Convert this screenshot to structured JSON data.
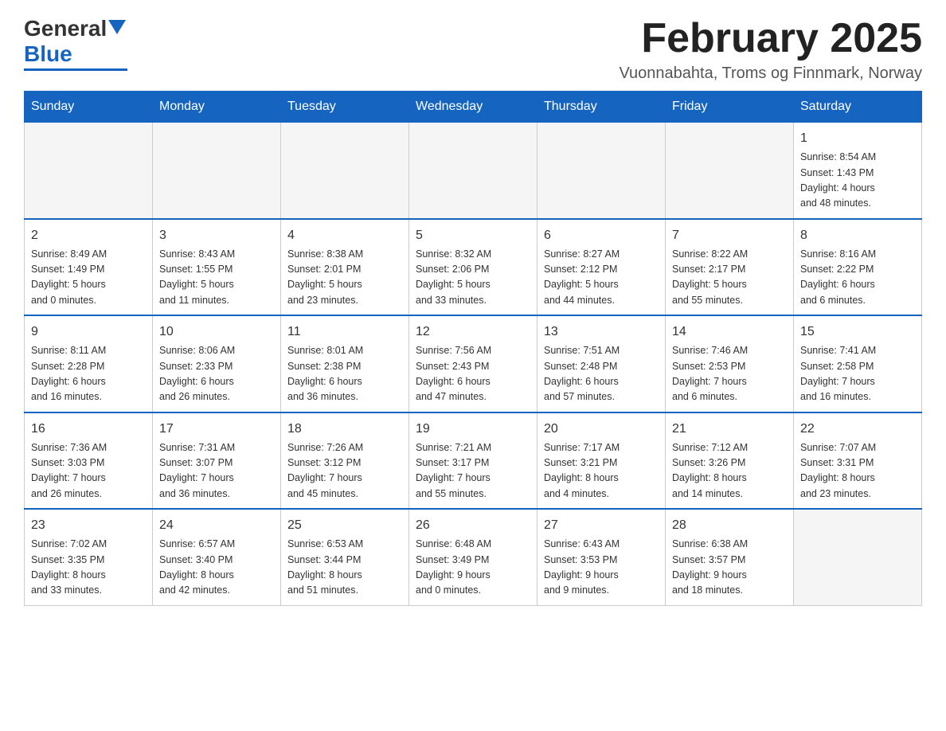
{
  "header": {
    "logo_text_general": "General",
    "logo_text_blue": "Blue",
    "month_title": "February 2025",
    "location": "Vuonnabahta, Troms og Finnmark, Norway"
  },
  "days_of_week": [
    "Sunday",
    "Monday",
    "Tuesday",
    "Wednesday",
    "Thursday",
    "Friday",
    "Saturday"
  ],
  "weeks": [
    {
      "days": [
        {
          "num": "",
          "info": ""
        },
        {
          "num": "",
          "info": ""
        },
        {
          "num": "",
          "info": ""
        },
        {
          "num": "",
          "info": ""
        },
        {
          "num": "",
          "info": ""
        },
        {
          "num": "",
          "info": ""
        },
        {
          "num": "1",
          "info": "Sunrise: 8:54 AM\nSunset: 1:43 PM\nDaylight: 4 hours\nand 48 minutes."
        }
      ]
    },
    {
      "days": [
        {
          "num": "2",
          "info": "Sunrise: 8:49 AM\nSunset: 1:49 PM\nDaylight: 5 hours\nand 0 minutes."
        },
        {
          "num": "3",
          "info": "Sunrise: 8:43 AM\nSunset: 1:55 PM\nDaylight: 5 hours\nand 11 minutes."
        },
        {
          "num": "4",
          "info": "Sunrise: 8:38 AM\nSunset: 2:01 PM\nDaylight: 5 hours\nand 23 minutes."
        },
        {
          "num": "5",
          "info": "Sunrise: 8:32 AM\nSunset: 2:06 PM\nDaylight: 5 hours\nand 33 minutes."
        },
        {
          "num": "6",
          "info": "Sunrise: 8:27 AM\nSunset: 2:12 PM\nDaylight: 5 hours\nand 44 minutes."
        },
        {
          "num": "7",
          "info": "Sunrise: 8:22 AM\nSunset: 2:17 PM\nDaylight: 5 hours\nand 55 minutes."
        },
        {
          "num": "8",
          "info": "Sunrise: 8:16 AM\nSunset: 2:22 PM\nDaylight: 6 hours\nand 6 minutes."
        }
      ]
    },
    {
      "days": [
        {
          "num": "9",
          "info": "Sunrise: 8:11 AM\nSunset: 2:28 PM\nDaylight: 6 hours\nand 16 minutes."
        },
        {
          "num": "10",
          "info": "Sunrise: 8:06 AM\nSunset: 2:33 PM\nDaylight: 6 hours\nand 26 minutes."
        },
        {
          "num": "11",
          "info": "Sunrise: 8:01 AM\nSunset: 2:38 PM\nDaylight: 6 hours\nand 36 minutes."
        },
        {
          "num": "12",
          "info": "Sunrise: 7:56 AM\nSunset: 2:43 PM\nDaylight: 6 hours\nand 47 minutes."
        },
        {
          "num": "13",
          "info": "Sunrise: 7:51 AM\nSunset: 2:48 PM\nDaylight: 6 hours\nand 57 minutes."
        },
        {
          "num": "14",
          "info": "Sunrise: 7:46 AM\nSunset: 2:53 PM\nDaylight: 7 hours\nand 6 minutes."
        },
        {
          "num": "15",
          "info": "Sunrise: 7:41 AM\nSunset: 2:58 PM\nDaylight: 7 hours\nand 16 minutes."
        }
      ]
    },
    {
      "days": [
        {
          "num": "16",
          "info": "Sunrise: 7:36 AM\nSunset: 3:03 PM\nDaylight: 7 hours\nand 26 minutes."
        },
        {
          "num": "17",
          "info": "Sunrise: 7:31 AM\nSunset: 3:07 PM\nDaylight: 7 hours\nand 36 minutes."
        },
        {
          "num": "18",
          "info": "Sunrise: 7:26 AM\nSunset: 3:12 PM\nDaylight: 7 hours\nand 45 minutes."
        },
        {
          "num": "19",
          "info": "Sunrise: 7:21 AM\nSunset: 3:17 PM\nDaylight: 7 hours\nand 55 minutes."
        },
        {
          "num": "20",
          "info": "Sunrise: 7:17 AM\nSunset: 3:21 PM\nDaylight: 8 hours\nand 4 minutes."
        },
        {
          "num": "21",
          "info": "Sunrise: 7:12 AM\nSunset: 3:26 PM\nDaylight: 8 hours\nand 14 minutes."
        },
        {
          "num": "22",
          "info": "Sunrise: 7:07 AM\nSunset: 3:31 PM\nDaylight: 8 hours\nand 23 minutes."
        }
      ]
    },
    {
      "days": [
        {
          "num": "23",
          "info": "Sunrise: 7:02 AM\nSunset: 3:35 PM\nDaylight: 8 hours\nand 33 minutes."
        },
        {
          "num": "24",
          "info": "Sunrise: 6:57 AM\nSunset: 3:40 PM\nDaylight: 8 hours\nand 42 minutes."
        },
        {
          "num": "25",
          "info": "Sunrise: 6:53 AM\nSunset: 3:44 PM\nDaylight: 8 hours\nand 51 minutes."
        },
        {
          "num": "26",
          "info": "Sunrise: 6:48 AM\nSunset: 3:49 PM\nDaylight: 9 hours\nand 0 minutes."
        },
        {
          "num": "27",
          "info": "Sunrise: 6:43 AM\nSunset: 3:53 PM\nDaylight: 9 hours\nand 9 minutes."
        },
        {
          "num": "28",
          "info": "Sunrise: 6:38 AM\nSunset: 3:57 PM\nDaylight: 9 hours\nand 18 minutes."
        },
        {
          "num": "",
          "info": ""
        }
      ]
    }
  ]
}
